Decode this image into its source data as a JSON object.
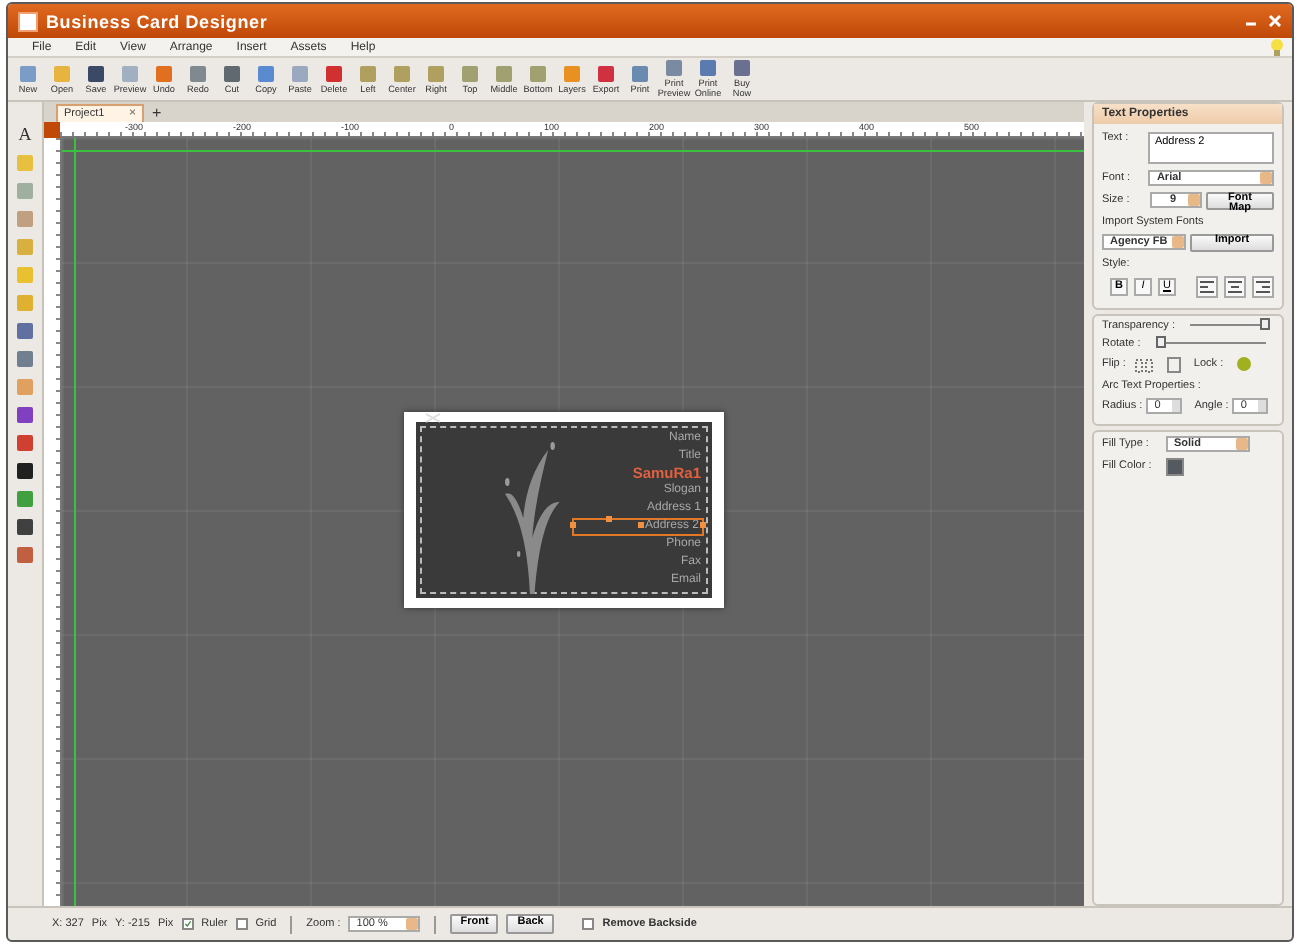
{
  "window": {
    "title": "Business Card Designer"
  },
  "menu": [
    "File",
    "Edit",
    "View",
    "Arrange",
    "Insert",
    "Assets",
    "Help"
  ],
  "toolbar": [
    "New",
    "Open",
    "Save",
    "Preview",
    "Undo",
    "Redo",
    "Cut",
    "Copy",
    "Paste",
    "Delete",
    "Left",
    "Center",
    "Right",
    "Top",
    "Middle",
    "Bottom",
    "Layers",
    "Export",
    "Print",
    "Print Preview",
    "Print Online",
    "Buy Now"
  ],
  "tool_palette": {
    "text_tool": "A"
  },
  "tabs": [
    {
      "label": "Project1",
      "selected": true
    }
  ],
  "tab_close": "×",
  "new_tab": "+",
  "ruler": {
    "labels": [
      "-300",
      "-200",
      "-100",
      "0",
      "100",
      "200",
      "300",
      "400",
      "500"
    ]
  },
  "card": {
    "lines": [
      {
        "text": "Name",
        "kind": "plain",
        "selected": false
      },
      {
        "text": "Title",
        "kind": "plain",
        "selected": false
      },
      {
        "text": "SamuRa1",
        "kind": "highlight",
        "selected": false
      },
      {
        "text": "Slogan",
        "kind": "plain",
        "selected": false
      },
      {
        "text": "Address 1",
        "kind": "plain",
        "selected": false
      },
      {
        "text": "Address 2",
        "kind": "plain",
        "selected": true
      },
      {
        "text": "Phone",
        "kind": "plain",
        "selected": false
      },
      {
        "text": "Fax",
        "kind": "plain",
        "selected": false
      },
      {
        "text": "Email",
        "kind": "plain",
        "selected": false
      }
    ]
  },
  "properties": {
    "title": "Text Properties",
    "text_label": "Text :",
    "text_value": "Address 2",
    "font_label": "Font :",
    "font": "Arial",
    "size_label": "Size :",
    "size": "9",
    "font_map": "Font Map",
    "import_label": "Import System Fonts",
    "system_font": "Agency FB",
    "import_button": "Import",
    "style_label": "Style:",
    "style_buttons": [
      {
        "label": "B",
        "on": false
      },
      {
        "label": "I",
        "on": false
      },
      {
        "label": "U",
        "on": false
      }
    ],
    "transparency": {
      "label": "Transparency :",
      "level": 1
    },
    "rotate": {
      "label": "Rotate :",
      "level": 0
    },
    "flip_label": "Flip :",
    "lock_label": "Lock :",
    "arc_label": "Arc Text Properties :",
    "radius": {
      "label": "Radius :",
      "value": "0"
    },
    "angle": {
      "label": "Angle :",
      "value": "0"
    },
    "fill_type_label": "Fill Type :",
    "fill_type": "Solid",
    "fill_color_label": "Fill Color :"
  },
  "status": {
    "x": "X: 327",
    "x_unit": "Pix",
    "y": "Y: -215",
    "y_unit": "Pix",
    "ruler": {
      "label": "Ruler",
      "checked": true
    },
    "grid": {
      "label": "Grid",
      "checked": false
    },
    "zoom_label": "Zoom :",
    "zoom": "100 %",
    "front": "Front",
    "back": "Back",
    "remove_backside": {
      "label": "Remove Backside",
      "checked": false
    }
  }
}
